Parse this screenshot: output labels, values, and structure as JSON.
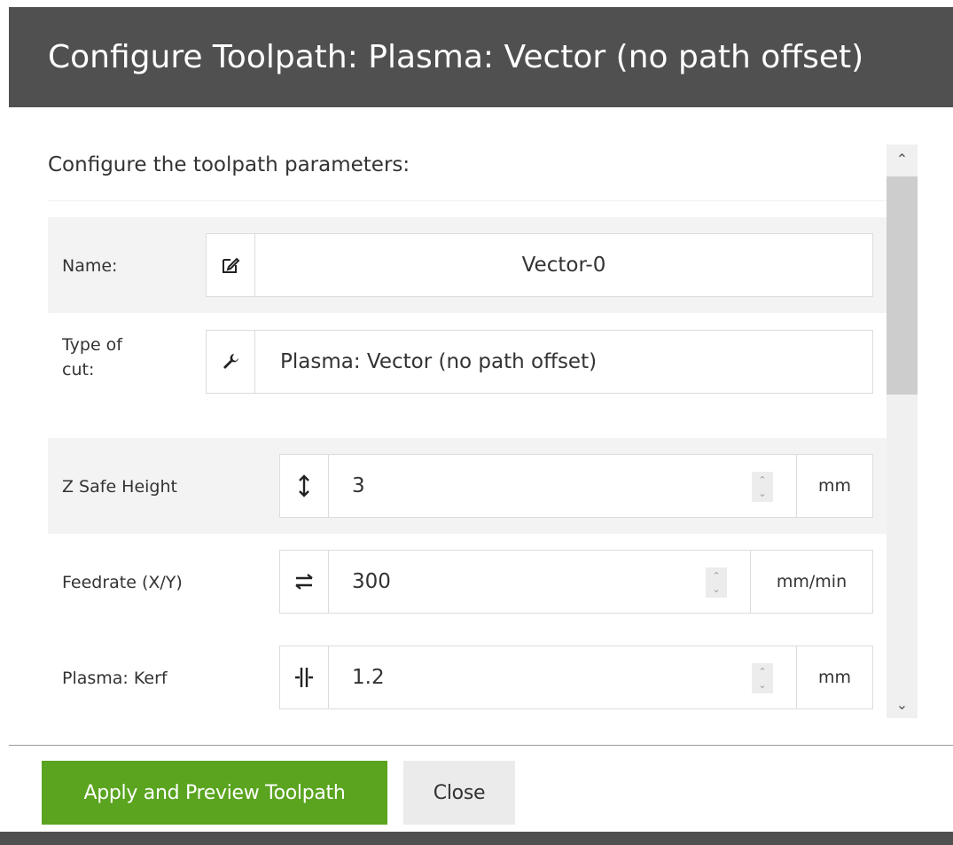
{
  "dialog": {
    "title": "Configure Toolpath: Plasma: Vector (no path offset)",
    "subtitle": "Configure the toolpath parameters:"
  },
  "fields": {
    "name": {
      "label": "Name:",
      "value": "Vector-0",
      "icon": "edit-icon"
    },
    "type_of_cut": {
      "label_line1": "Type of",
      "label_line2": "cut:",
      "value": "Plasma: Vector (no path offset)",
      "icon": "wrench-icon"
    },
    "z_safe_height": {
      "label": "Z Safe Height",
      "value": "3",
      "unit": "mm",
      "icon": "vertical-arrows-icon"
    },
    "feedrate": {
      "label": "Feedrate (X/Y)",
      "value": "300",
      "unit": "mm/min",
      "icon": "horizontal-arrows-icon"
    },
    "kerf": {
      "label": "Plasma: Kerf",
      "value": "1.2",
      "unit": "mm",
      "icon": "kerf-icon"
    }
  },
  "buttons": {
    "apply": "Apply and Preview Toolpath",
    "close": "Close"
  },
  "colors": {
    "titlebar": "#505050",
    "apply_button": "#5aa41f",
    "close_button": "#ebebeb"
  }
}
